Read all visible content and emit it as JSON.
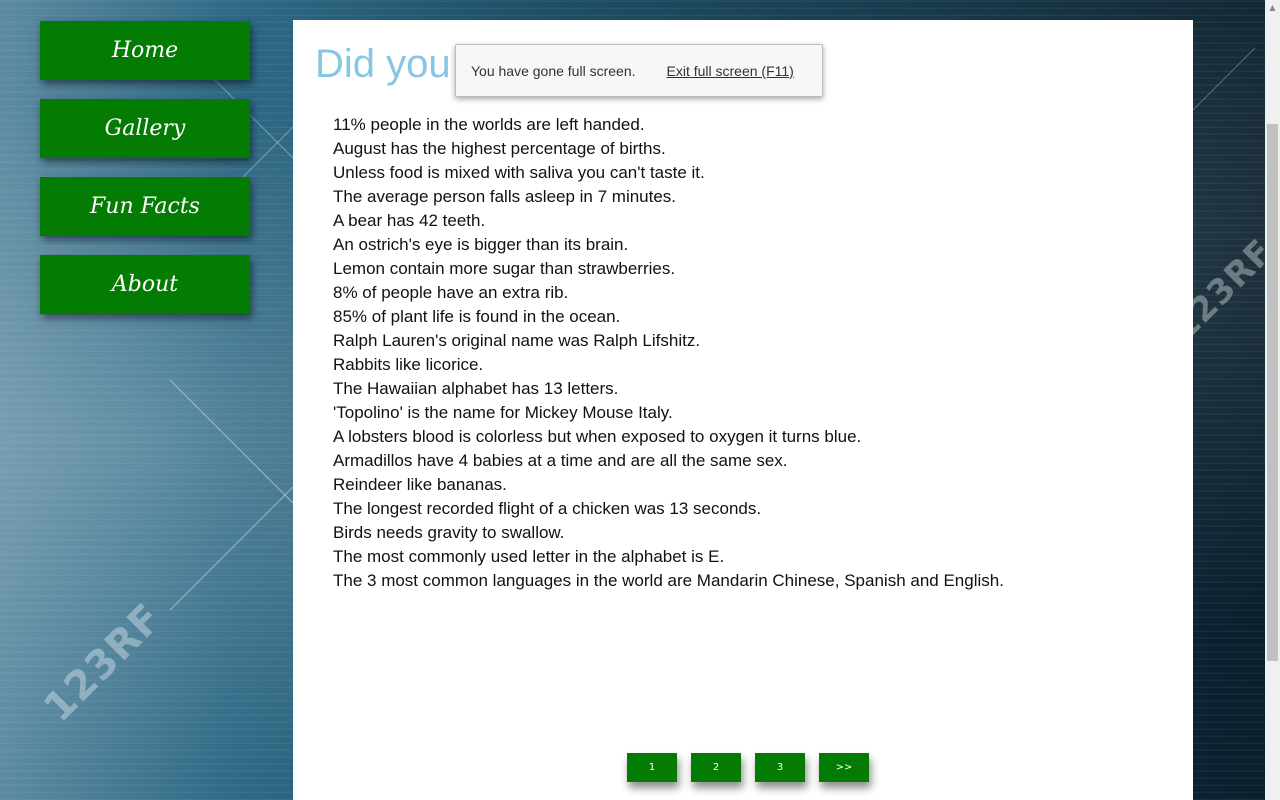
{
  "nav": {
    "items": [
      {
        "label": "Home"
      },
      {
        "label": "Gallery"
      },
      {
        "label": "Fun Facts"
      },
      {
        "label": "About"
      }
    ]
  },
  "main": {
    "heading": "Did you",
    "facts": [
      "11% people in the worlds are left handed.",
      "August has the highest percentage of births.",
      "Unless food is mixed with saliva you can't taste it.",
      "The average person falls asleep in 7 minutes.",
      "A bear has 42 teeth.",
      "An ostrich's eye is bigger than its brain.",
      "Lemon contain more sugar than strawberries.",
      "8% of people have an extra rib.",
      "85% of plant life is found in the ocean.",
      "Ralph Lauren's original name was Ralph Lifshitz.",
      "Rabbits like licorice.",
      "The Hawaiian alphabet has 13 letters.",
      "'Topolino' is the name for Mickey Mouse Italy.",
      "A lobsters blood is colorless but when exposed to oxygen it turns blue.",
      "Armadillos have 4 babies at a time and are all the same sex.",
      "Reindeer like bananas.",
      "The longest recorded flight of a chicken was 13 seconds.",
      "Birds needs gravity to swallow.",
      "The most commonly used letter in the alphabet is E.",
      "The 3 most common languages in the world are Mandarin Chinese, Spanish and English."
    ]
  },
  "pagination": {
    "pages": [
      "1",
      "2",
      "3"
    ],
    "next_label": ">>"
  },
  "fullscreen_notice": {
    "message": "You have gone full screen.",
    "exit_label": "Exit full screen (F11)"
  },
  "watermark": {
    "text": "123RF"
  },
  "colors": {
    "nav_button": "#047c04",
    "heading": "#87c6e4",
    "panel": "#ffffff"
  }
}
